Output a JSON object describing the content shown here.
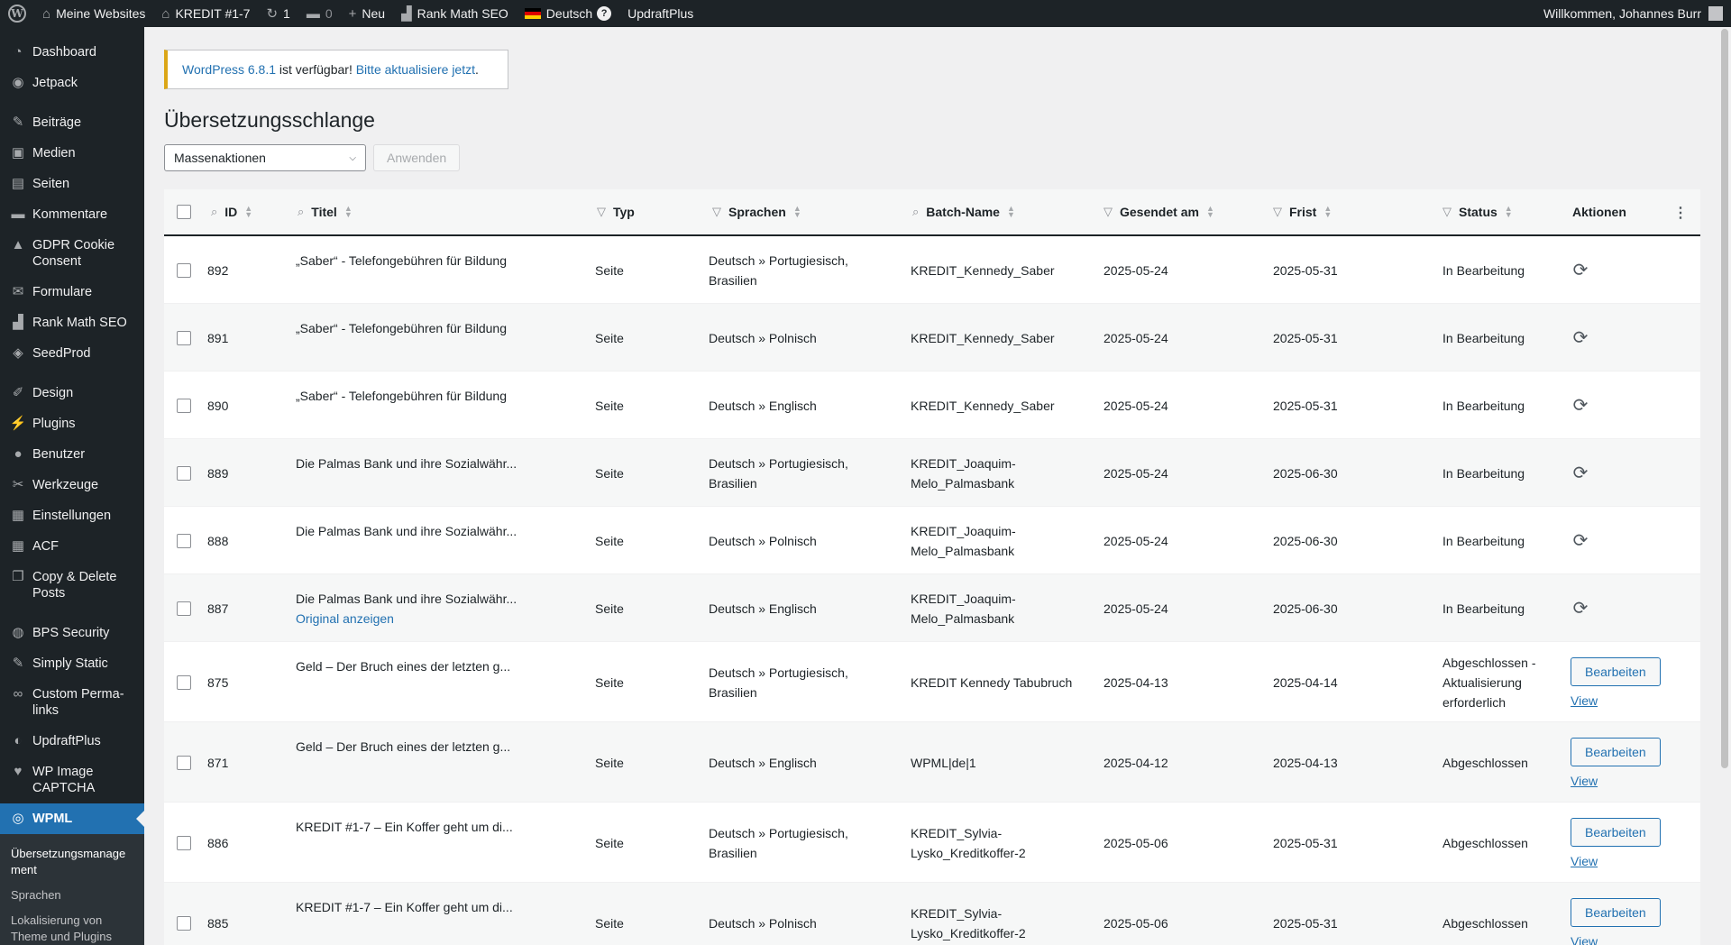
{
  "adminbar": {
    "my_sites": "Meine Websites",
    "site_name": "KREDIT #1-7",
    "updates_count": "1",
    "comments_count": "0",
    "new_label": "Neu",
    "rank_math": "Rank Math SEO",
    "language": "Deutsch",
    "help": "?",
    "updraft": "UpdraftPlus",
    "welcome": "Willkommen, Johannes Burr"
  },
  "sidebar": {
    "items": [
      {
        "label": "Dashboard",
        "icon": "dashboard-icon",
        "glyph": "◔"
      },
      {
        "label": "Jetpack",
        "icon": "jetpack-icon",
        "glyph": "◉"
      },
      {
        "label": "Beiträge",
        "icon": "pin-icon",
        "glyph": "✎"
      },
      {
        "label": "Medien",
        "icon": "media-icon",
        "glyph": "▣"
      },
      {
        "label": "Seiten",
        "icon": "pages-icon",
        "glyph": "▤"
      },
      {
        "label": "Kommentare",
        "icon": "comment-icon",
        "glyph": "▬"
      },
      {
        "label": "GDPR Cookie Consent",
        "icon": "lock-icon",
        "glyph": "▲"
      },
      {
        "label": "Formulare",
        "icon": "mail-icon",
        "glyph": "✉"
      },
      {
        "label": "Rank Math SEO",
        "icon": "chart-icon",
        "glyph": "▟"
      },
      {
        "label": "SeedProd",
        "icon": "seedprod-icon",
        "glyph": "◈"
      },
      {
        "label": "Design",
        "icon": "brush-icon",
        "glyph": "✐"
      },
      {
        "label": "Plugins",
        "icon": "plugin-icon",
        "glyph": "⚡"
      },
      {
        "label": "Benutzer",
        "icon": "user-icon",
        "glyph": "●"
      },
      {
        "label": "Werkzeuge",
        "icon": "wrench-icon",
        "glyph": "✂"
      },
      {
        "label": "Einstellungen",
        "icon": "settings-icon",
        "glyph": "▦"
      },
      {
        "label": "ACF",
        "icon": "acf-icon",
        "glyph": "▦"
      },
      {
        "label": "Copy & Delete Posts",
        "icon": "copy-icon",
        "glyph": "❐"
      },
      {
        "label": "BPS Security",
        "icon": "shield-icon",
        "glyph": "◍"
      },
      {
        "label": "Simply Static",
        "icon": "static-icon",
        "glyph": "✎"
      },
      {
        "label": "Custom Perma-links",
        "icon": "link-icon",
        "glyph": "∞"
      },
      {
        "label": "UpdraftPlus",
        "icon": "updraft-icon",
        "glyph": "◐"
      },
      {
        "label": "WP Image CAPTCHA",
        "icon": "captcha-icon",
        "glyph": "♥"
      },
      {
        "label": "WPML",
        "icon": "wpml-icon",
        "glyph": "◎"
      }
    ],
    "submenu": [
      "Übersetzungsmanage ment",
      "Sprachen",
      "Lokalisierung von Theme und Plugins"
    ]
  },
  "notice": {
    "version_link": "WordPress 6.8.1",
    "middle": " ist verfügbar! ",
    "update_link": "Bitte aktualisiere jetzt",
    "end": "."
  },
  "page": {
    "title": "Übersetzungsschlange",
    "bulk_placeholder": "Massenaktionen",
    "apply": "Anwenden"
  },
  "table": {
    "headers": {
      "id": "ID",
      "title": "Titel",
      "type": "Typ",
      "languages": "Sprachen",
      "batch": "Batch-Name",
      "sent": "Gesendet am",
      "deadline": "Frist",
      "status": "Status",
      "actions": "Aktionen"
    },
    "rows": [
      {
        "id": "892",
        "title": "„Saber“ - Telefongebühren für Bildung",
        "type": "Seite",
        "languages": "Deutsch » Portugiesisch, Brasilien",
        "batch": "KREDIT_Kennedy_Saber",
        "sent": "2025-05-24",
        "deadline": "2025-05-31",
        "status": "In Bearbeitung",
        "action": "refresh",
        "extra": ""
      },
      {
        "id": "891",
        "title": "„Saber“ - Telefongebühren für Bildung",
        "type": "Seite",
        "languages": "Deutsch » Polnisch",
        "batch": "KREDIT_Kennedy_Saber",
        "sent": "2025-05-24",
        "deadline": "2025-05-31",
        "status": "In Bearbeitung",
        "action": "refresh",
        "extra": ""
      },
      {
        "id": "890",
        "title": "„Saber“ - Telefongebühren für Bildung",
        "type": "Seite",
        "languages": "Deutsch » Englisch",
        "batch": "KREDIT_Kennedy_Saber",
        "sent": "2025-05-24",
        "deadline": "2025-05-31",
        "status": "In Bearbeitung",
        "action": "refresh",
        "extra": ""
      },
      {
        "id": "889",
        "title": "Die Palmas Bank und ihre Sozialwähr...",
        "type": "Seite",
        "languages": "Deutsch » Portugiesisch, Brasilien",
        "batch": "KREDIT_Joaquim-Melo_Palmasbank",
        "sent": "2025-05-24",
        "deadline": "2025-06-30",
        "status": "In Bearbeitung",
        "action": "refresh",
        "extra": ""
      },
      {
        "id": "888",
        "title": "Die Palmas Bank und ihre Sozialwähr...",
        "type": "Seite",
        "languages": "Deutsch » Polnisch",
        "batch": "KREDIT_Joaquim-Melo_Palmasbank",
        "sent": "2025-05-24",
        "deadline": "2025-06-30",
        "status": "In Bearbeitung",
        "action": "refresh",
        "extra": ""
      },
      {
        "id": "887",
        "title": "Die Palmas Bank und ihre Sozialwähr...",
        "type": "Seite",
        "languages": "Deutsch » Englisch",
        "batch": "KREDIT_Joaquim-Melo_Palmasbank",
        "sent": "2025-05-24",
        "deadline": "2025-06-30",
        "status": "In Bearbeitung",
        "action": "refresh",
        "extra": "Original anzeigen"
      },
      {
        "id": "875",
        "title": "Geld – Der Bruch eines der letzten g...",
        "type": "Seite",
        "languages": "Deutsch » Portugiesisch, Brasilien",
        "batch": "KREDIT Kennedy Tabubruch",
        "sent": "2025-04-13",
        "deadline": "2025-04-14",
        "status": "Abgeschlossen - Aktualisierung erforderlich",
        "action": "edit",
        "extra": ""
      },
      {
        "id": "871",
        "title": "Geld – Der Bruch eines der letzten g...",
        "type": "Seite",
        "languages": "Deutsch » Englisch",
        "batch": "WPML|de|1",
        "sent": "2025-04-12",
        "deadline": "2025-04-13",
        "status": "Abgeschlossen",
        "action": "edit",
        "extra": ""
      },
      {
        "id": "886",
        "title": "KREDIT #1-7 – Ein Koffer geht um di...",
        "type": "Seite",
        "languages": "Deutsch » Portugiesisch, Brasilien",
        "batch": "KREDIT_Sylvia-Lysko_Kreditkoffer-2",
        "sent": "2025-05-06",
        "deadline": "2025-05-31",
        "status": "Abgeschlossen",
        "action": "edit",
        "extra": ""
      },
      {
        "id": "885",
        "title": "KREDIT #1-7 – Ein Koffer geht um di...",
        "type": "Seite",
        "languages": "Deutsch » Polnisch",
        "batch": "KREDIT_Sylvia-Lysko_Kreditkoffer-2",
        "sent": "2025-05-06",
        "deadline": "2025-05-31",
        "status": "Abgeschlossen",
        "action": "edit",
        "extra": ""
      }
    ],
    "edit_label": "Bearbeiten",
    "view_label": "View"
  }
}
